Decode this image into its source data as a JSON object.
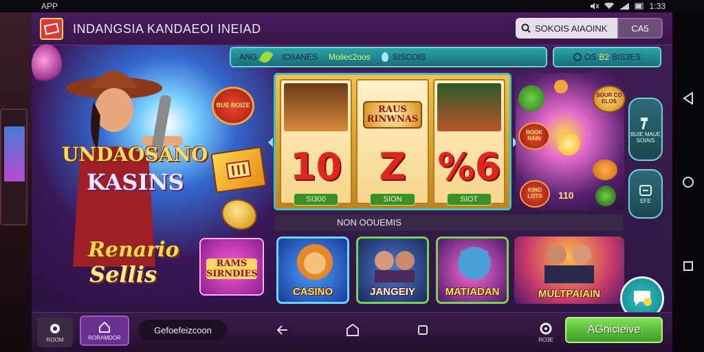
{
  "status_bar": {
    "app_label": "APP",
    "time": "1:33"
  },
  "header": {
    "title": "INDANGSIA KANDAEOI INEIAD",
    "search_placeholder": "SOKOIS AIAOINK",
    "search_button": "CA5"
  },
  "promo": {
    "badge": "BUE BOIZE",
    "title_line1": "UNDAOSANO",
    "title_line2": "KASINS",
    "subtitle_line1": "Renario",
    "subtitle_line2": "Sellis"
  },
  "filters": {
    "items": [
      {
        "label": "ANG",
        "icon": "leaf-icon"
      },
      {
        "label": "IOIIANES",
        "icon": ""
      },
      {
        "label": "Moliec2oos",
        "icon": ""
      },
      {
        "label": "SISCOIS",
        "icon": "drop-icon"
      }
    ],
    "balance": {
      "prefix": "C",
      "label": "OS",
      "highlight": "B2",
      "amount": "BIS3ES"
    }
  },
  "slot": {
    "reels": [
      {
        "number": "10",
        "label": "SI300"
      },
      {
        "number": "Z",
        "label": "SION",
        "banner": "RAUS RINWNAS"
      },
      {
        "number": "%6",
        "label": "SIOT"
      }
    ]
  },
  "bonus": {
    "badge_top": "SOUR CO ELOS",
    "badge_left": "BOOK RAIN",
    "badge_bottom": "KINO LOTS",
    "amount": "110"
  },
  "side_buttons": [
    {
      "icon": "hammer-icon",
      "label": "BUIE MAUE SOIAIS"
    },
    {
      "icon": "menu-icon",
      "label": "EFE"
    }
  ],
  "section": {
    "title": "NON OOUEMIS"
  },
  "games": [
    {
      "label": "RAMS SIRNDIES",
      "name": "tile-rams"
    },
    {
      "label": "CASINO",
      "name": "tile-casino"
    },
    {
      "label": "JANGEIY",
      "name": "tile-jangeiy"
    },
    {
      "label": "MATIADAN",
      "name": "tile-matiadan"
    },
    {
      "label": "MULTPAIAIN",
      "name": "tile-multpaiain"
    }
  ],
  "bottom_bar": {
    "home_label": "ROOM",
    "lobby_label": "RORAMDOR",
    "promo_code": "Gefoefeizcoon",
    "settings_label": "RO3E",
    "cta_label": "AGnicieive"
  },
  "colors": {
    "accent_teal": "#2aa3a8",
    "frame_purple": "#41205a",
    "cta_green": "#5fc23a",
    "title_gold": "#ffdc5e"
  }
}
